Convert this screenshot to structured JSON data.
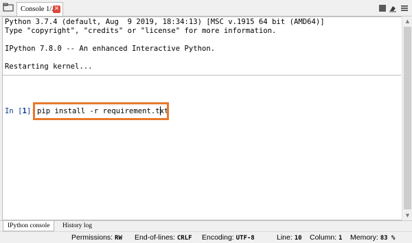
{
  "tabs": {
    "console_tab_label": "Console 1/A",
    "close_symbol": "✕"
  },
  "console": {
    "lines": [
      "Python 3.7.4 (default, Aug  9 2019, 18:34:13) [MSC v.1915 64 bit (AMD64)]",
      "Type \"copyright\", \"credits\" or \"license\" for more information.",
      "",
      "IPython 7.8.0 -- An enhanced Interactive Python.",
      "",
      "Restarting kernel..."
    ],
    "prompt_prefix": "In [",
    "prompt_number": "1",
    "prompt_suffix": "]:",
    "input_value": "pip install -r requirement.txt",
    "highlight_color": "#e8782a"
  },
  "bottom_tabs": {
    "ipython_console": "IPython console",
    "history_log": "History log"
  },
  "status": {
    "permissions_label": "Permissions:",
    "permissions_value": "RW",
    "eol_label": "End-of-lines:",
    "eol_value": "CRLF",
    "encoding_label": "Encoding:",
    "encoding_value": "UTF-8",
    "line_label": "Line:",
    "line_value": "10",
    "column_label": "Column:",
    "column_value": "1",
    "memory_label": "Memory:",
    "memory_value": "83 %"
  },
  "icons": [
    "browse-tabs-icon",
    "close-icon",
    "stop-icon",
    "clear-console-icon",
    "options-menu-icon",
    "scroll-up-icon",
    "scroll-down-icon"
  ]
}
